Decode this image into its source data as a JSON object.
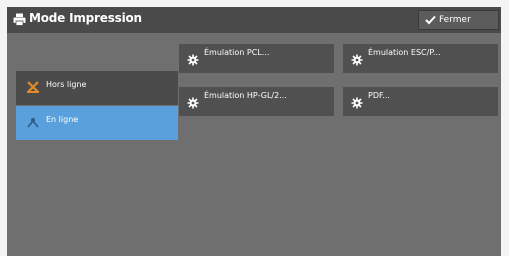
{
  "window": {
    "title": "Mode Impression",
    "close_label": "Fermer"
  },
  "sidebar": {
    "items": [
      {
        "label": "Hors ligne",
        "selected": false
      },
      {
        "label": "En ligne",
        "selected": true
      }
    ]
  },
  "main": {
    "buttons": [
      {
        "label": "Émulation PCL..."
      },
      {
        "label": "Émulation ESC/P..."
      },
      {
        "label": "Émulation HP-GL/2..."
      },
      {
        "label": "PDF..."
      }
    ]
  },
  "colors": {
    "screen_bg": "#6f6f6f",
    "titlebar_bg": "#4a4a4a",
    "selected_accent": "#5aa0dc",
    "button_bg": "#505050",
    "offline_icon": "#e08a2a"
  }
}
